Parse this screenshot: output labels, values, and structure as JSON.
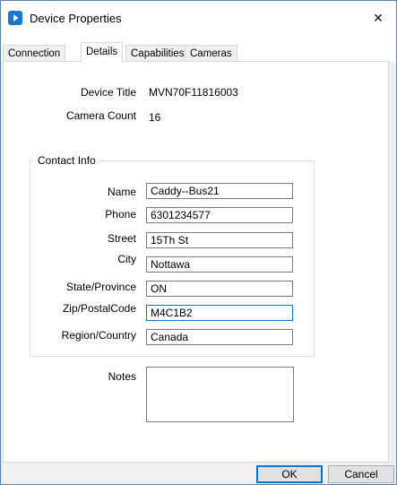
{
  "window": {
    "title": "Device Properties",
    "close_glyph": "×"
  },
  "tabs": [
    {
      "label": "Connection"
    },
    {
      "label": "Details"
    },
    {
      "label": "Capabilities"
    },
    {
      "label": "Cameras"
    }
  ],
  "active_tab": "Details",
  "details": {
    "device_title_label": "Device Title",
    "device_title_value": "MVN70F11816003",
    "camera_count_label": "Camera Count",
    "camera_count_value": "16"
  },
  "contact": {
    "group_title": "Contact Info",
    "fields": [
      {
        "label": "Name",
        "value": "Caddy--Bus21"
      },
      {
        "label": "Phone",
        "value": "6301234577"
      },
      {
        "label": "Street",
        "value": "15Th St"
      },
      {
        "label": "City",
        "value": "Nottawa"
      },
      {
        "label": "State/Province",
        "value": "ON"
      },
      {
        "label": "Zip/PostalCode",
        "value": "M4C1B2"
      },
      {
        "label": "Region/Country",
        "value": "Canada"
      }
    ]
  },
  "notes": {
    "label": "Notes",
    "value": ""
  },
  "buttons": {
    "ok": "OK",
    "cancel": "Cancel"
  },
  "colors": {
    "accent": "#0078d7",
    "app_icon": "#1976d2"
  }
}
